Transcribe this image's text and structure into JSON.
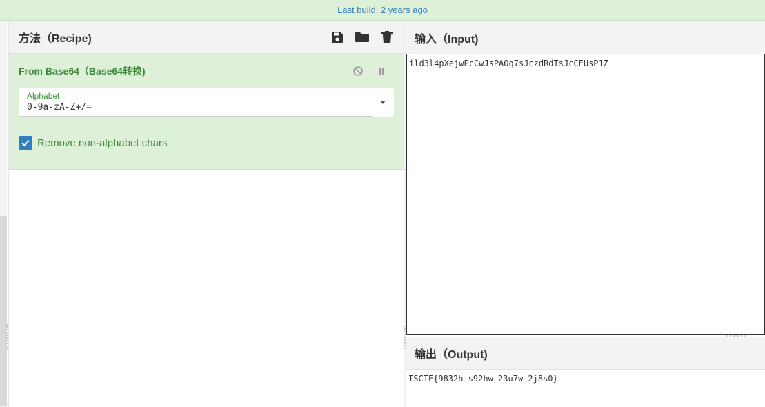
{
  "banner": {
    "text": "Last build: 2 years ago"
  },
  "recipe": {
    "title": "方法（Recipe)",
    "icons": [
      "save-icon",
      "folder-icon",
      "trash-icon"
    ]
  },
  "operation": {
    "title": "From Base64（Base64转换)",
    "controls": [
      "disable-icon",
      "pause-icon"
    ],
    "alphabet": {
      "label": "Alphabet",
      "value": "0-9a-zA-Z+/="
    },
    "remove_non_alphabet": {
      "label": "Remove non-alphabet chars",
      "checked": true
    }
  },
  "input": {
    "title": "输入（Input)",
    "value": "ild3l4pXejwPcCwJsPAOq7sJczdRdTsJcCEUsP1Z"
  },
  "output": {
    "title": "输出（Output)",
    "value": "ISCTF{9832h-s92hw-23u7w-2j8s0}"
  },
  "colors": {
    "accent_blue": "#2f7fc1",
    "operation_green": "#3c8a3c",
    "operation_bg": "#dff0d8"
  }
}
